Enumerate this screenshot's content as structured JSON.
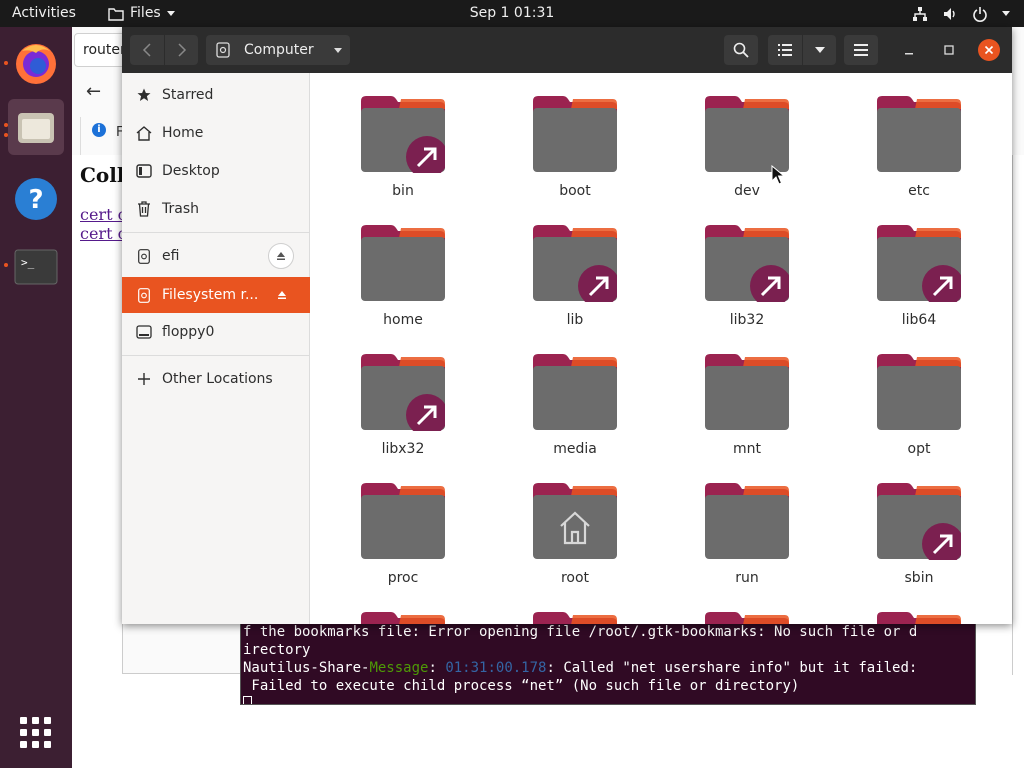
{
  "topbar": {
    "activities": "Activities",
    "app_menu": "Files",
    "clock": "Sep 1  01:31"
  },
  "background_window": {
    "tab_label": "router",
    "info_text": "F",
    "page_heading": "Coll",
    "links": [
      "cert c",
      "cert c"
    ]
  },
  "nautilus": {
    "path_label": "Computer",
    "sidebar": [
      {
        "label": "Starred",
        "icon": "star-icon"
      },
      {
        "label": "Home",
        "icon": "home-icon"
      },
      {
        "label": "Desktop",
        "icon": "desktop-icon"
      },
      {
        "label": "Trash",
        "icon": "trash-icon"
      },
      {
        "label": "efi",
        "icon": "drive-icon"
      },
      {
        "label": "Filesystem r...",
        "icon": "drive-icon"
      },
      {
        "label": "floppy0",
        "icon": "floppy-icon"
      },
      {
        "label": "Other Locations",
        "icon": "plus-icon"
      }
    ],
    "folders": [
      {
        "name": "bin",
        "link": true
      },
      {
        "name": "boot",
        "link": false
      },
      {
        "name": "dev",
        "link": false
      },
      {
        "name": "etc",
        "link": false
      },
      {
        "name": "home",
        "link": false
      },
      {
        "name": "lib",
        "link": true
      },
      {
        "name": "lib32",
        "link": true
      },
      {
        "name": "lib64",
        "link": true
      },
      {
        "name": "libx32",
        "link": true
      },
      {
        "name": "media",
        "link": false
      },
      {
        "name": "mnt",
        "link": false
      },
      {
        "name": "opt",
        "link": false
      },
      {
        "name": "proc",
        "link": false
      },
      {
        "name": "root",
        "link": false,
        "home_emblem": true
      },
      {
        "name": "run",
        "link": false
      },
      {
        "name": "sbin",
        "link": true
      }
    ]
  },
  "terminal": {
    "line1": "f the bookmarks file: Error opening file /root/.gtk-bookmarks: No such file or d",
    "line2": "irectory",
    "line3_prefix": "Nautilus-Share-",
    "line3_msg": "Message",
    "line3_colon": ": ",
    "line3_time": "01:31:00.178",
    "line3_rest": ": Called \"net usershare info\" but it failed:",
    "line4": " Failed to execute child process “net” (No such file or directory)"
  },
  "colors": {
    "accent": "#e95420",
    "folder_tab": "#9b2350",
    "folder_body": "#6c6c6c",
    "dock_bg": "#3c1f32",
    "terminal_bg": "#300a24"
  }
}
